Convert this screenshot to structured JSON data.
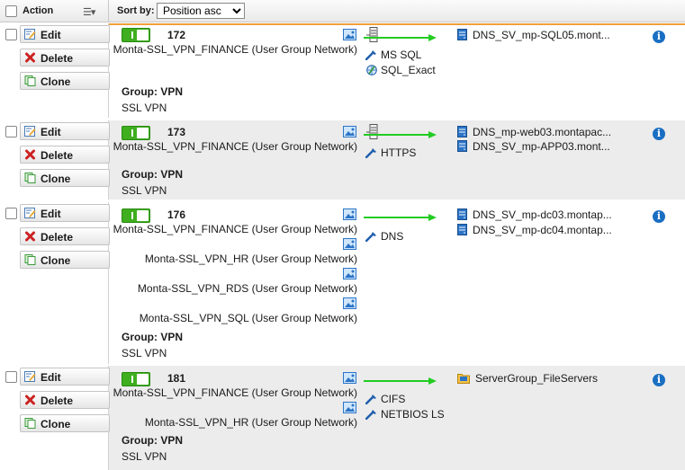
{
  "header": {
    "action": "Action",
    "sort_label": "Sort by:",
    "sort_value": "Position asc",
    "sort_options": [
      "Position asc"
    ]
  },
  "buttons": {
    "edit": "Edit",
    "delete": "Delete",
    "clone": "Clone"
  },
  "rows": [
    {
      "position": "172",
      "sources": [
        "Monta-SSL_VPN_FINANCE (User Group Network)"
      ],
      "services": [
        "MS SQL",
        "SQL_Exact"
      ],
      "destinations": [
        "DNS_SV_mp-SQL05.mont..."
      ],
      "group_label": "Group: VPN",
      "group_value": "SSL VPN"
    },
    {
      "position": "173",
      "sources": [
        "Monta-SSL_VPN_FINANCE (User Group Network)"
      ],
      "services": [
        "HTTPS"
      ],
      "destinations": [
        "DNS_mp-web03.montapac...",
        "DNS_SV_mp-APP03.mont..."
      ],
      "group_label": "Group: VPN",
      "group_value": "SSL VPN"
    },
    {
      "position": "176",
      "sources": [
        "Monta-SSL_VPN_FINANCE (User Group Network)",
        "Monta-SSL_VPN_HR (User Group Network)",
        "Monta-SSL_VPN_RDS (User Group Network)",
        "Monta-SSL_VPN_SQL (User Group Network)"
      ],
      "services": [
        "DNS"
      ],
      "destinations": [
        "DNS_SV_mp-dc03.montap...",
        "DNS_SV_mp-dc04.montap..."
      ],
      "group_label": "Group: VPN",
      "group_value": "SSL VPN"
    },
    {
      "position": "181",
      "sources": [
        "Monta-SSL_VPN_FINANCE (User Group Network)",
        "Monta-SSL_VPN_HR (User Group Network)"
      ],
      "services": [
        "CIFS",
        "NETBIOS LS"
      ],
      "destinations": [
        "ServerGroup_FileServers"
      ],
      "group_label": "Group: VPN",
      "group_value": "SSL VPN"
    }
  ],
  "colors": {
    "toggle_on": "#3fae1f",
    "arrow": "#22cc22",
    "accent": "#f0a038",
    "info": "#1a6fc2"
  }
}
